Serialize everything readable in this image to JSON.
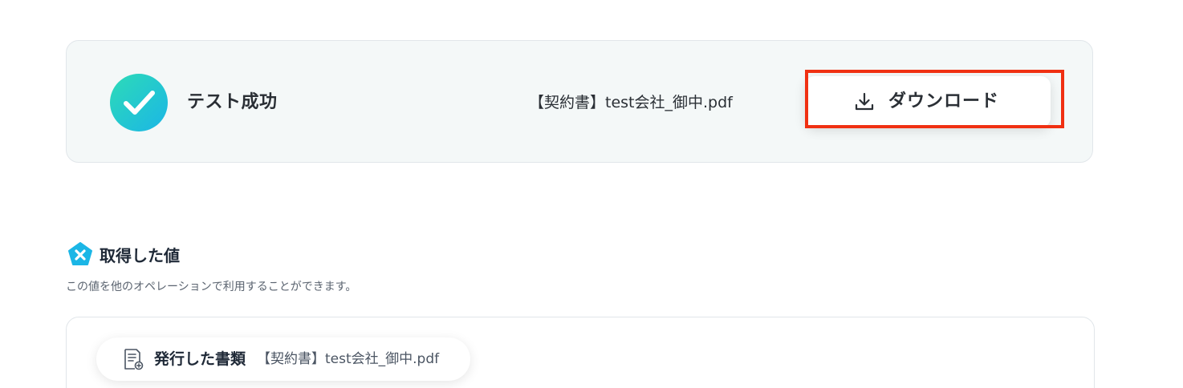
{
  "result": {
    "status": "テスト成功",
    "file_name": "【契約書】test会社_御中.pdf",
    "download_label": "ダウンロード"
  },
  "acquired": {
    "title": "取得した値",
    "description": "この値を他のオペレーションで利用することができます。",
    "items": [
      {
        "label": "発行した書類",
        "value": "【契約書】test会社_御中.pdf"
      }
    ]
  },
  "colors": {
    "success_gradient_start": "#2ddbb7",
    "success_gradient_end": "#1bb6e6",
    "highlight": "#f03012",
    "yoom_icon": "#1bb6e6"
  },
  "icons": {
    "status": "check-icon",
    "download": "download-icon",
    "section": "yoom-logo-icon",
    "item": "document-icon"
  }
}
